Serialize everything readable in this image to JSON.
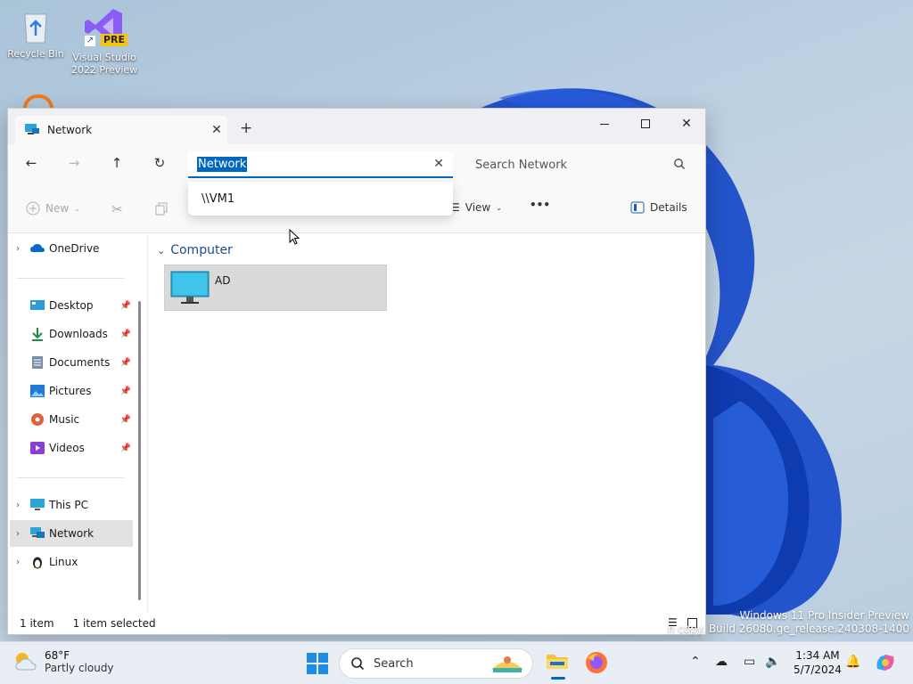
{
  "desktop": {
    "icons": [
      {
        "label": "Recycle Bin"
      },
      {
        "label": "Visual Studio 2022 Preview",
        "badge": "PRE"
      }
    ],
    "watermark": {
      "line1": "Windows 11 Pro Insider Preview",
      "line2": "n copy. Build 26080.ge_release.240308-1400"
    }
  },
  "window": {
    "tab": {
      "title": "Network",
      "close_icon": "close-icon"
    },
    "new_tab_label": "+",
    "controls": {
      "minimize": "minimize-icon",
      "maximize": "maximize-icon",
      "close": "close-icon"
    },
    "address": {
      "value": "Network",
      "clear_icon": "close-icon"
    },
    "search": {
      "placeholder": "Search Network"
    },
    "autocomplete": {
      "suggestion": "\\\\VM1"
    },
    "commandbar": {
      "new_label": "New",
      "view_label": "View",
      "more_label": "•••",
      "details_label": "Details"
    },
    "sidebar": {
      "items": [
        {
          "label": "OneDrive",
          "icon": "cloud-icon",
          "expandable": true
        },
        {
          "label": "Desktop",
          "icon": "desktop-icon",
          "pinned": true
        },
        {
          "label": "Downloads",
          "icon": "download-icon",
          "pinned": true
        },
        {
          "label": "Documents",
          "icon": "document-icon",
          "pinned": true
        },
        {
          "label": "Pictures",
          "icon": "pictures-icon",
          "pinned": true
        },
        {
          "label": "Music",
          "icon": "music-icon",
          "pinned": true
        },
        {
          "label": "Videos",
          "icon": "videos-icon",
          "pinned": true
        },
        {
          "label": "This PC",
          "icon": "computer-icon",
          "expandable": true
        },
        {
          "label": "Network",
          "icon": "network-icon",
          "expandable": true,
          "selected": true
        },
        {
          "label": "Linux",
          "icon": "linux-icon",
          "expandable": true
        }
      ]
    },
    "content": {
      "group": "Computer",
      "items": [
        {
          "label": "AD",
          "icon": "computer-icon"
        }
      ]
    },
    "status": {
      "count": "1 item",
      "selection": "1 item selected"
    }
  },
  "taskbar": {
    "weather": {
      "temp": "68°F",
      "condition": "Partly cloudy"
    },
    "search_label": "Search",
    "clock": {
      "time": "1:34 AM",
      "date": "5/7/2024"
    }
  },
  "colors": {
    "accent": "#0067c0",
    "selection": "#e2e2e2"
  }
}
